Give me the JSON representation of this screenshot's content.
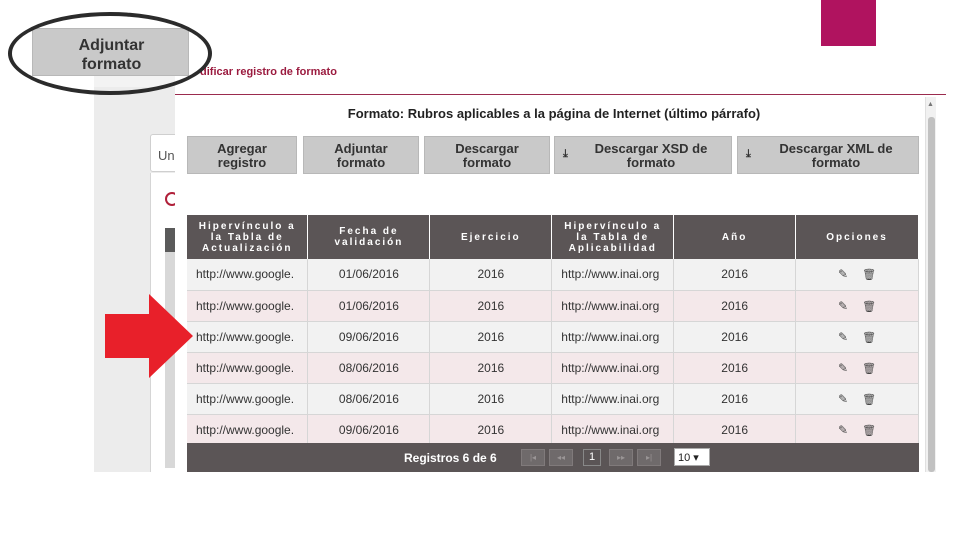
{
  "background": {
    "tab_label": "Un"
  },
  "modal": {
    "title": "dificar registro de formato",
    "format_heading": "Formato: Rubros aplicables a la página de Internet (último párrafo)"
  },
  "toolbar": {
    "buttons": [
      {
        "label": "Agregar registro",
        "icon": ""
      },
      {
        "label": "Adjuntar formato",
        "icon": ""
      },
      {
        "label": "Descargar formato",
        "icon": ""
      },
      {
        "label": "Descargar XSD de formato",
        "icon": "download-icon"
      },
      {
        "label": "Descargar XML de formato",
        "icon": "download-icon"
      }
    ]
  },
  "table": {
    "headers": [
      "Hipervínculo a la Tabla de Actualización",
      "Fecha de validación",
      "Ejercicio",
      "Hipervínculo a la Tabla de Aplicabilidad",
      "Año",
      "Opciones"
    ],
    "rows": [
      [
        "http://www.google.",
        "01/06/2016",
        "2016",
        "http://www.inai.org",
        "2016"
      ],
      [
        "http://www.google.",
        "01/06/2016",
        "2016",
        "http://www.inai.org",
        "2016"
      ],
      [
        "http://www.google.",
        "09/06/2016",
        "2016",
        "http://www.inai.org",
        "2016"
      ],
      [
        "http://www.google.",
        "08/06/2016",
        "2016",
        "http://www.inai.org",
        "2016"
      ],
      [
        "http://www.google.",
        "08/06/2016",
        "2016",
        "http://www.inai.org",
        "2016"
      ],
      [
        "http://www.google.",
        "09/06/2016",
        "2016",
        "http://www.inai.org",
        "2016"
      ]
    ]
  },
  "pager": {
    "label": "Registros 6 de 6",
    "first": "|◂",
    "prev": "◂◂",
    "current_page": "1",
    "next": "▸▸",
    "last": "▸|",
    "page_size": "10 ▾"
  },
  "annotation": {
    "zoom_label": "Adjuntar formato"
  },
  "colors": {
    "accent": "#b0135f",
    "header_bg": "#5b5556",
    "arrow": "#e8202a"
  }
}
